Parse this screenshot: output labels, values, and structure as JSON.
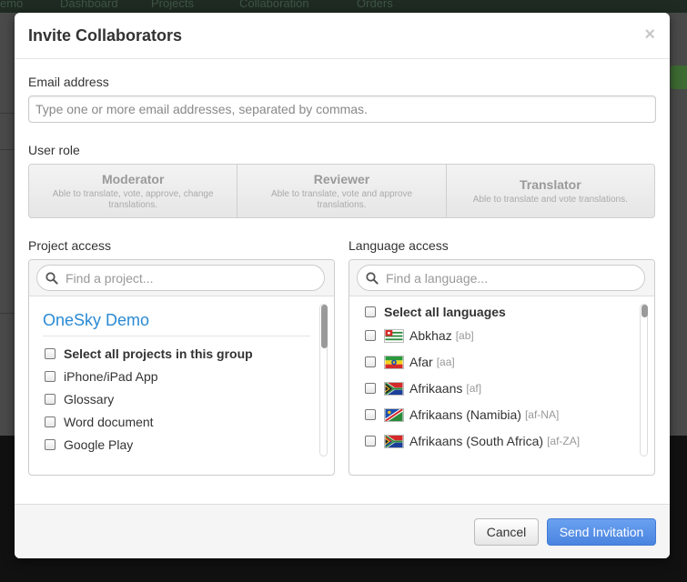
{
  "background_nav": {
    "brand_fragment": "emo",
    "items": [
      "Dashboard",
      "Projects",
      "Collaboration",
      "Orders"
    ]
  },
  "modal": {
    "title": "Invite Collaborators",
    "close_glyph": "×",
    "email": {
      "label": "Email address",
      "placeholder": "Type one or more email addresses, separated by commas.",
      "value": ""
    },
    "user_role": {
      "label": "User role",
      "options": [
        {
          "name": "Moderator",
          "description": "Able to translate, vote, approve, change translations."
        },
        {
          "name": "Reviewer",
          "description": "Able to translate, vote and approve translations."
        },
        {
          "name": "Translator",
          "description": "Able to translate and vote translations."
        }
      ]
    },
    "project_access": {
      "label": "Project access",
      "search_placeholder": "Find a project...",
      "group_title": "OneSky Demo",
      "select_all": "Select all projects in this group",
      "projects": [
        "iPhone/iPad App",
        "Glossary",
        "Word document",
        "Google Play"
      ]
    },
    "language_access": {
      "label": "Language access",
      "search_placeholder": "Find a language...",
      "select_all": "Select all languages",
      "languages": [
        {
          "name": "Abkhaz",
          "code": "[ab]",
          "flag_icon": "abkhazia-flag-icon"
        },
        {
          "name": "Afar",
          "code": "[aa]",
          "flag_icon": "ethiopia-flag-icon"
        },
        {
          "name": "Afrikaans",
          "code": "[af]",
          "flag_icon": "south-africa-flag-icon"
        },
        {
          "name": "Afrikaans (Namibia)",
          "code": "[af-NA]",
          "flag_icon": "namibia-flag-icon"
        },
        {
          "name": "Afrikaans (South Africa)",
          "code": "[af-ZA]",
          "flag_icon": "south-africa-flag-icon"
        }
      ]
    },
    "footer": {
      "cancel_label": "Cancel",
      "send_label": "Send Invitation"
    }
  },
  "colors": {
    "accent_link": "#2a8ad4",
    "primary_button": "#5591e8"
  }
}
